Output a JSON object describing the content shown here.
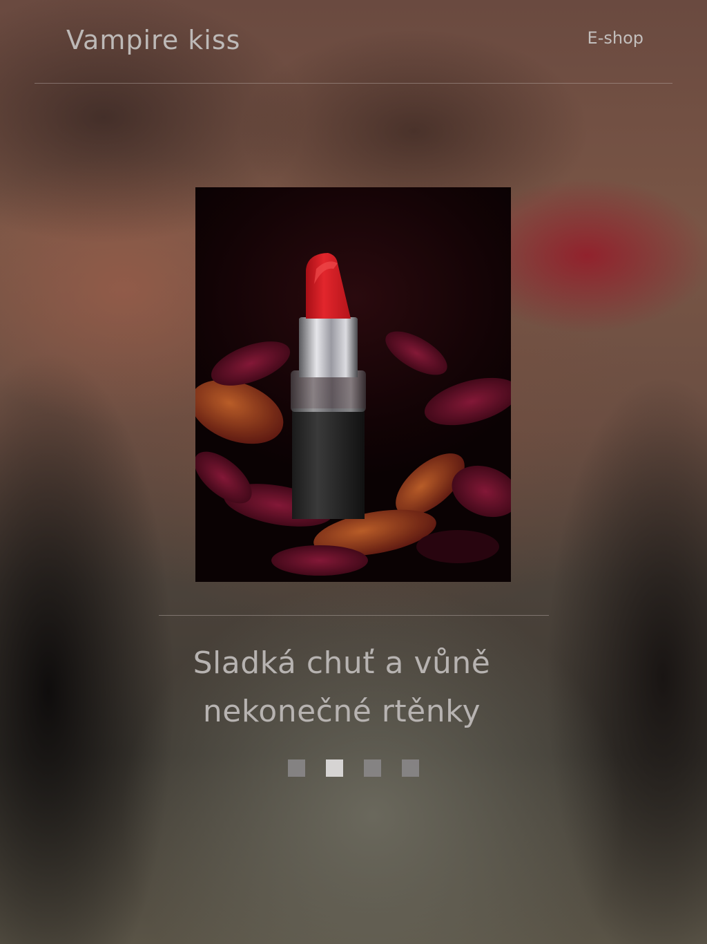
{
  "header": {
    "brand": "Vampire kiss",
    "nav_link": "E-shop"
  },
  "hero": {
    "image_icon": "lipstick-photo"
  },
  "slide": {
    "caption_line1": "Sladká chuť  a vůně",
    "caption_line2": "nekonečné rtěnky"
  },
  "slider": {
    "dot_count": 4,
    "active_index": 1
  },
  "colors": {
    "text": "#b9b6b5",
    "dot_inactive": "#8c8a8c",
    "dot_active": "#d6d4d3",
    "lipstick": "#d41f24"
  }
}
